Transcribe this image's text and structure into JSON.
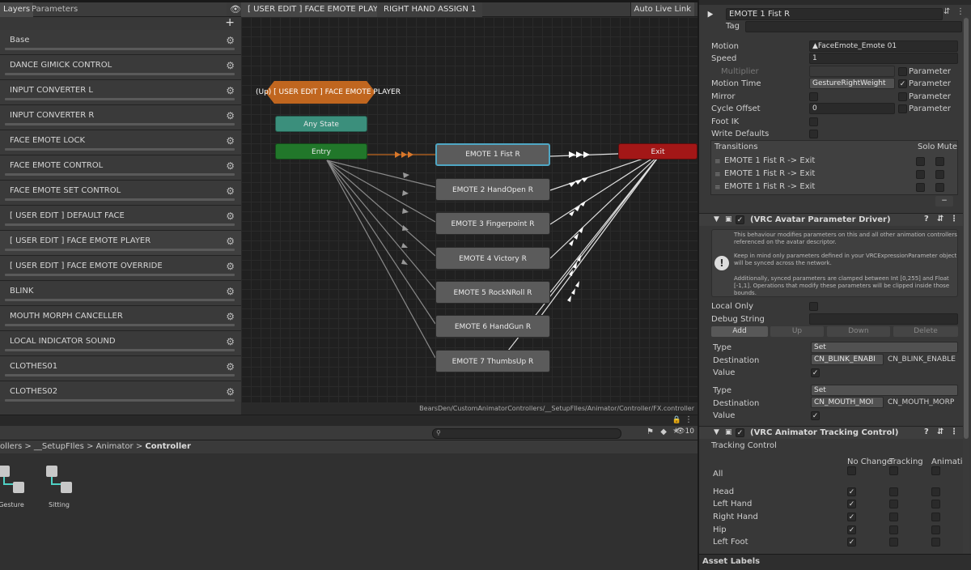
{
  "left_panel": {
    "tabs": [
      "Layers",
      "Parameters"
    ],
    "add_label": "+",
    "layers": [
      "Base",
      "DANCE GIMICK CONTROL",
      "INPUT CONVERTER L",
      "INPUT CONVERTER R",
      "FACE EMOTE LOCK",
      "FACE EMOTE CONTROL",
      "FACE EMOTE SET CONTROL",
      "[ USER EDIT ] DEFAULT FACE",
      "[ USER EDIT ] FACE EMOTE PLAYER",
      "[ USER EDIT ] FACE EMOTE OVERRIDE",
      "BLINK",
      "MOUTH MORPH CANCELLER",
      "LOCAL INDICATOR SOUND",
      "CLOTHES01",
      "CLOTHES02"
    ],
    "selected_layer": "[ USER EDIT ] FACE EMOTE PLAYER"
  },
  "graph": {
    "breadcrumb": [
      "[ USER EDIT ] FACE EMOTE PLAYER",
      "RIGHT HAND ASSIGN 1"
    ],
    "auto_live_link": "Auto Live Link",
    "up_node": "(Up) [ USER EDIT ] FACE EMOTE PLAYER",
    "any_state": "Any State",
    "entry": "Entry",
    "exit": "Exit",
    "states": [
      "EMOTE 1 Fist R",
      "EMOTE 2 HandOpen R",
      "EMOTE 3 Fingerpoint R",
      "EMOTE 4 Victory R",
      "EMOTE 5 RockNRoll R",
      "EMOTE 6 HandGun R",
      "EMOTE 7 ThumbsUp R"
    ],
    "path": "BearsDen/CustomAnimatorControllers/__SetupFIles/Animator/Controller/FX.controller"
  },
  "project": {
    "breadcrumb": [
      "ollers",
      ">",
      "__SetupFIles",
      ">",
      "Animator",
      ">",
      "Controller"
    ],
    "count": "10",
    "assets": [
      "Gesture",
      "Sitting"
    ]
  },
  "inspector": {
    "title": "EMOTE 1 Fist R",
    "tag_label": "Tag",
    "motion_label": "Motion",
    "motion_value": "FaceEmote_Emote 01",
    "speed_label": "Speed",
    "speed_value": "1",
    "multiplier_label": "Multiplier",
    "motion_time_label": "Motion Time",
    "motion_time_value": "GestureRightWeight",
    "mirror_label": "Mirror",
    "cycle_offset_label": "Cycle Offset",
    "cycle_offset_value": "0",
    "foot_ik_label": "Foot IK",
    "write_defaults_label": "Write Defaults",
    "parameter_label": "Parameter",
    "transitions_label": "Transitions",
    "solo_label": "Solo",
    "mute_label": "Mute",
    "transitions": [
      "EMOTE 1 Fist R -> Exit",
      "EMOTE 1 Fist R -> Exit",
      "EMOTE 1 Fist R -> Exit"
    ],
    "minus": "−",
    "driver_title": "(VRC Avatar Parameter Driver)",
    "help_text_1": "This behaviour modifies parameters on this and all other animation controllers referenced on the avatar descriptor.",
    "help_text_2": "Keep in mind only parameters defined in your VRCExpressionParameter object will be synced across the network.",
    "help_text_3": "Additionally, synced parameters are clamped between Int [0,255] and Float [-1,1]. Operations that modify these parameters will be clipped inside those bounds.",
    "local_only_label": "Local Only",
    "debug_string_label": "Debug String",
    "buttons": [
      "Add",
      "Up",
      "Down",
      "Delete"
    ],
    "type_label": "Type",
    "destination_label": "Destination",
    "value_label": "Value",
    "entries": [
      {
        "type": "Set",
        "destination": "CN_BLINK_ENABI",
        "destination_text": "CN_BLINK_ENABLE"
      },
      {
        "type": "Set",
        "destination": "CN_MOUTH_MOI",
        "destination_text": "CN_MOUTH_MORP"
      }
    ],
    "tracking_title": "(VRC Animator Tracking Control)",
    "tracking_control_label": "Tracking Control",
    "tracking_headers": [
      "No Change",
      "Tracking",
      "Animatio"
    ],
    "tracking_rows": [
      "All",
      "Head",
      "Left Hand",
      "Right Hand",
      "Hip",
      "Left Foot"
    ],
    "asset_labels": "Asset Labels"
  },
  "colors": {
    "entry": "#21772a",
    "any_state": "#3b8f7c",
    "exit": "#a31717",
    "up_node": "#c0661f",
    "selected_outline": "#4fa7c4"
  }
}
